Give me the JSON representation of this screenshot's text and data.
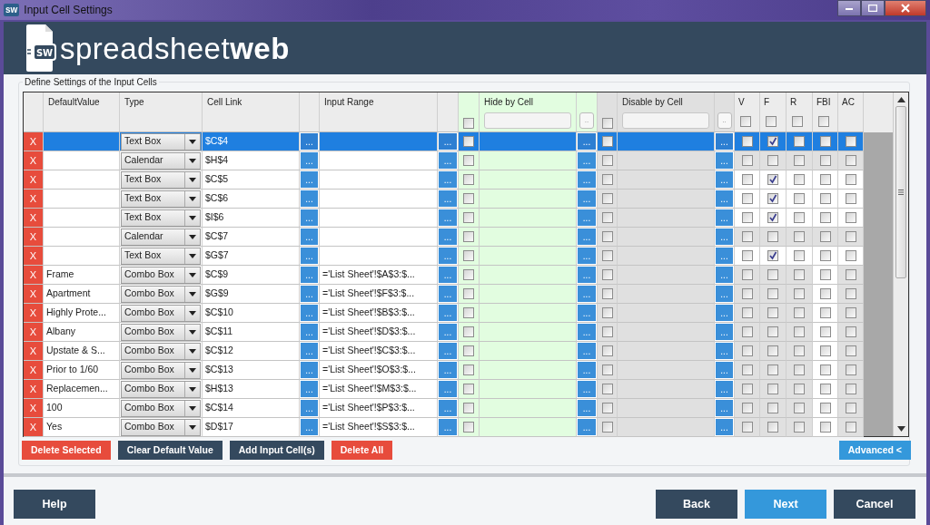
{
  "window": {
    "icon_text": "sw",
    "title": "Input Cell Settings"
  },
  "logo": {
    "badge": "SW",
    "light": "spreadsheet",
    "bold": "web"
  },
  "group_title": "Define Settings of the Input Cells",
  "header": {
    "default_value": "DefaultValue",
    "type": "Type",
    "cell_link": "Cell Link",
    "input_range": "Input Range",
    "hide": {
      "label": "Hide by Cell",
      "checked": false,
      "button": ".."
    },
    "disable": {
      "label": "Disable by Cell",
      "checked": false,
      "button": ".."
    },
    "flags": [
      {
        "label": "V",
        "checked": false
      },
      {
        "label": "F",
        "checked": false
      },
      {
        "label": "R",
        "checked": false
      },
      {
        "label": "FBI",
        "checked": false
      },
      {
        "label": "AC"
      }
    ]
  },
  "rows": [
    {
      "delete": "X",
      "type": "Text Box",
      "cell_link": "$C$4",
      "link_button": "...",
      "range_button": "...",
      "hide_checked": false,
      "hide_button": "...",
      "disable_checked": false,
      "disable_button": "...",
      "selected": true,
      "flags": [
        {
          "checked": false,
          "enabled": true
        },
        {
          "checked": true,
          "enabled": true
        },
        {
          "checked": false,
          "enabled": true
        },
        {
          "checked": false,
          "enabled": true
        },
        {
          "checked": false,
          "enabled": true
        }
      ]
    },
    {
      "delete": "X",
      "type": "Calendar",
      "cell_link": "$H$4",
      "link_button": "...",
      "range_button": "...",
      "hide_checked": false,
      "hide_button": "...",
      "disable_checked": false,
      "disable_button": "...",
      "selected": false,
      "flags": [
        {
          "checked": false,
          "enabled": false
        },
        {
          "checked": false,
          "enabled": false
        },
        {
          "checked": false,
          "enabled": false
        },
        {
          "checked": false,
          "enabled": false
        },
        {
          "checked": false,
          "enabled": false
        }
      ]
    },
    {
      "delete": "X",
      "type": "Text Box",
      "cell_link": "$C$5",
      "link_button": "...",
      "range_button": "...",
      "hide_checked": false,
      "hide_button": "...",
      "disable_checked": false,
      "disable_button": "...",
      "selected": false,
      "flags": [
        {
          "checked": false,
          "enabled": true
        },
        {
          "checked": true,
          "enabled": true
        },
        {
          "checked": false,
          "enabled": true
        },
        {
          "checked": false,
          "enabled": true
        },
        {
          "checked": false,
          "enabled": true
        }
      ]
    },
    {
      "delete": "X",
      "type": "Text Box",
      "cell_link": "$C$6",
      "link_button": "...",
      "range_button": "...",
      "hide_checked": false,
      "hide_button": "...",
      "disable_checked": false,
      "disable_button": "...",
      "selected": false,
      "flags": [
        {
          "checked": false,
          "enabled": true
        },
        {
          "checked": true,
          "enabled": true
        },
        {
          "checked": false,
          "enabled": true
        },
        {
          "checked": false,
          "enabled": true
        },
        {
          "checked": false,
          "enabled": true
        }
      ]
    },
    {
      "delete": "X",
      "type": "Text Box",
      "cell_link": "$I$6",
      "link_button": "...",
      "range_button": "...",
      "hide_checked": false,
      "hide_button": "...",
      "disable_checked": false,
      "disable_button": "...",
      "selected": false,
      "flags": [
        {
          "checked": false,
          "enabled": true
        },
        {
          "checked": true,
          "enabled": true
        },
        {
          "checked": false,
          "enabled": true
        },
        {
          "checked": false,
          "enabled": true
        },
        {
          "checked": false,
          "enabled": true
        }
      ]
    },
    {
      "delete": "X",
      "type": "Calendar",
      "cell_link": "$C$7",
      "link_button": "...",
      "range_button": "...",
      "hide_checked": false,
      "hide_button": "...",
      "disable_checked": false,
      "disable_button": "...",
      "selected": false,
      "flags": [
        {
          "checked": false,
          "enabled": false
        },
        {
          "checked": false,
          "enabled": false
        },
        {
          "checked": false,
          "enabled": false
        },
        {
          "checked": false,
          "enabled": false
        },
        {
          "checked": false,
          "enabled": false
        }
      ]
    },
    {
      "delete": "X",
      "type": "Text Box",
      "cell_link": "$G$7",
      "link_button": "...",
      "range_button": "...",
      "hide_checked": false,
      "hide_button": "...",
      "disable_checked": false,
      "disable_button": "...",
      "selected": false,
      "flags": [
        {
          "checked": false,
          "enabled": true
        },
        {
          "checked": true,
          "enabled": true
        },
        {
          "checked": false,
          "enabled": true
        },
        {
          "checked": false,
          "enabled": true
        },
        {
          "checked": false,
          "enabled": true
        }
      ]
    },
    {
      "delete": "X",
      "default_value": "Frame",
      "type": "Combo Box",
      "cell_link": "$C$9",
      "link_button": "...",
      "input_range": "='List Sheet'!$A$3:$...",
      "range_button": "...",
      "hide_checked": false,
      "hide_button": "...",
      "disable_checked": false,
      "disable_button": "...",
      "selected": false,
      "flags": [
        {
          "checked": false,
          "enabled": false
        },
        {
          "checked": false,
          "enabled": false
        },
        {
          "checked": false,
          "enabled": false
        },
        {
          "checked": false,
          "enabled": true
        },
        {
          "checked": false,
          "enabled": false
        }
      ]
    },
    {
      "delete": "X",
      "default_value": "Apartment",
      "type": "Combo Box",
      "cell_link": "$G$9",
      "link_button": "...",
      "input_range": "='List Sheet'!$F$3:$...",
      "range_button": "...",
      "hide_checked": false,
      "hide_button": "...",
      "disable_checked": false,
      "disable_button": "...",
      "selected": false,
      "flags": [
        {
          "checked": false,
          "enabled": false
        },
        {
          "checked": false,
          "enabled": false
        },
        {
          "checked": false,
          "enabled": false
        },
        {
          "checked": false,
          "enabled": true
        },
        {
          "checked": false,
          "enabled": false
        }
      ]
    },
    {
      "delete": "X",
      "default_value": "Highly Prote...",
      "type": "Combo Box",
      "cell_link": "$C$10",
      "link_button": "...",
      "input_range": "='List Sheet'!$B$3:$...",
      "range_button": "...",
      "hide_checked": false,
      "hide_button": "...",
      "disable_checked": false,
      "disable_button": "...",
      "selected": false,
      "flags": [
        {
          "checked": false,
          "enabled": false
        },
        {
          "checked": false,
          "enabled": false
        },
        {
          "checked": false,
          "enabled": false
        },
        {
          "checked": false,
          "enabled": true
        },
        {
          "checked": false,
          "enabled": false
        }
      ]
    },
    {
      "delete": "X",
      "default_value": "Albany",
      "type": "Combo Box",
      "cell_link": "$C$11",
      "link_button": "...",
      "input_range": "='List Sheet'!$D$3:$...",
      "range_button": "...",
      "hide_checked": false,
      "hide_button": "...",
      "disable_checked": false,
      "disable_button": "...",
      "selected": false,
      "flags": [
        {
          "checked": false,
          "enabled": false
        },
        {
          "checked": false,
          "enabled": false
        },
        {
          "checked": false,
          "enabled": false
        },
        {
          "checked": false,
          "enabled": true
        },
        {
          "checked": false,
          "enabled": false
        }
      ]
    },
    {
      "delete": "X",
      "default_value": "Upstate & S...",
      "type": "Combo Box",
      "cell_link": "$C$12",
      "link_button": "...",
      "input_range": "='List Sheet'!$C$3:$...",
      "range_button": "...",
      "hide_checked": false,
      "hide_button": "...",
      "disable_checked": false,
      "disable_button": "...",
      "selected": false,
      "flags": [
        {
          "checked": false,
          "enabled": false
        },
        {
          "checked": false,
          "enabled": false
        },
        {
          "checked": false,
          "enabled": false
        },
        {
          "checked": false,
          "enabled": true
        },
        {
          "checked": false,
          "enabled": false
        }
      ]
    },
    {
      "delete": "X",
      "default_value": "Prior to 1/60",
      "type": "Combo Box",
      "cell_link": "$C$13",
      "link_button": "...",
      "input_range": "='List Sheet'!$O$3:$...",
      "range_button": "...",
      "hide_checked": false,
      "hide_button": "...",
      "disable_checked": false,
      "disable_button": "...",
      "selected": false,
      "flags": [
        {
          "checked": false,
          "enabled": false
        },
        {
          "checked": false,
          "enabled": false
        },
        {
          "checked": false,
          "enabled": false
        },
        {
          "checked": false,
          "enabled": true
        },
        {
          "checked": false,
          "enabled": false
        }
      ]
    },
    {
      "delete": "X",
      "default_value": "Replacemen...",
      "type": "Combo Box",
      "cell_link": "$H$13",
      "link_button": "...",
      "input_range": "='List Sheet'!$M$3:$...",
      "range_button": "...",
      "hide_checked": false,
      "hide_button": "...",
      "disable_checked": false,
      "disable_button": "...",
      "selected": false,
      "flags": [
        {
          "checked": false,
          "enabled": false
        },
        {
          "checked": false,
          "enabled": false
        },
        {
          "checked": false,
          "enabled": false
        },
        {
          "checked": false,
          "enabled": true
        },
        {
          "checked": false,
          "enabled": false
        }
      ]
    },
    {
      "delete": "X",
      "default_value": "100",
      "type": "Combo Box",
      "cell_link": "$C$14",
      "link_button": "...",
      "input_range": "='List Sheet'!$P$3:$...",
      "range_button": "...",
      "hide_checked": false,
      "hide_button": "...",
      "disable_checked": false,
      "disable_button": "...",
      "selected": false,
      "flags": [
        {
          "checked": false,
          "enabled": false
        },
        {
          "checked": false,
          "enabled": false
        },
        {
          "checked": false,
          "enabled": false
        },
        {
          "checked": false,
          "enabled": true
        },
        {
          "checked": false,
          "enabled": false
        }
      ]
    },
    {
      "delete": "X",
      "default_value": "Yes",
      "type": "Combo Box",
      "cell_link": "$D$17",
      "link_button": "...",
      "input_range": "='List Sheet'!$S$3:$...",
      "range_button": "...",
      "hide_checked": false,
      "hide_button": "...",
      "disable_checked": false,
      "disable_button": "...",
      "selected": false,
      "flags": [
        {
          "checked": false,
          "enabled": false
        },
        {
          "checked": false,
          "enabled": false
        },
        {
          "checked": false,
          "enabled": false
        },
        {
          "checked": false,
          "enabled": true
        },
        {
          "checked": false,
          "enabled": false
        }
      ]
    }
  ],
  "actions": [
    {
      "label": "Delete Selected",
      "kind": "danger"
    },
    {
      "label": "Clear  Default Value",
      "kind": "dark"
    },
    {
      "label": "Add Input Cell(s)",
      "kind": "dark"
    },
    {
      "label": "Delete All",
      "kind": "danger"
    }
  ],
  "advanced": {
    "label": "Advanced <",
    "kind": "primary"
  },
  "footer_left": [
    {
      "label": "Help",
      "kind": "dark"
    }
  ],
  "footer_right": [
    {
      "label": "Back",
      "kind": "dark"
    },
    {
      "label": "Next",
      "kind": "primary"
    },
    {
      "label": "Cancel",
      "kind": "dark"
    }
  ]
}
